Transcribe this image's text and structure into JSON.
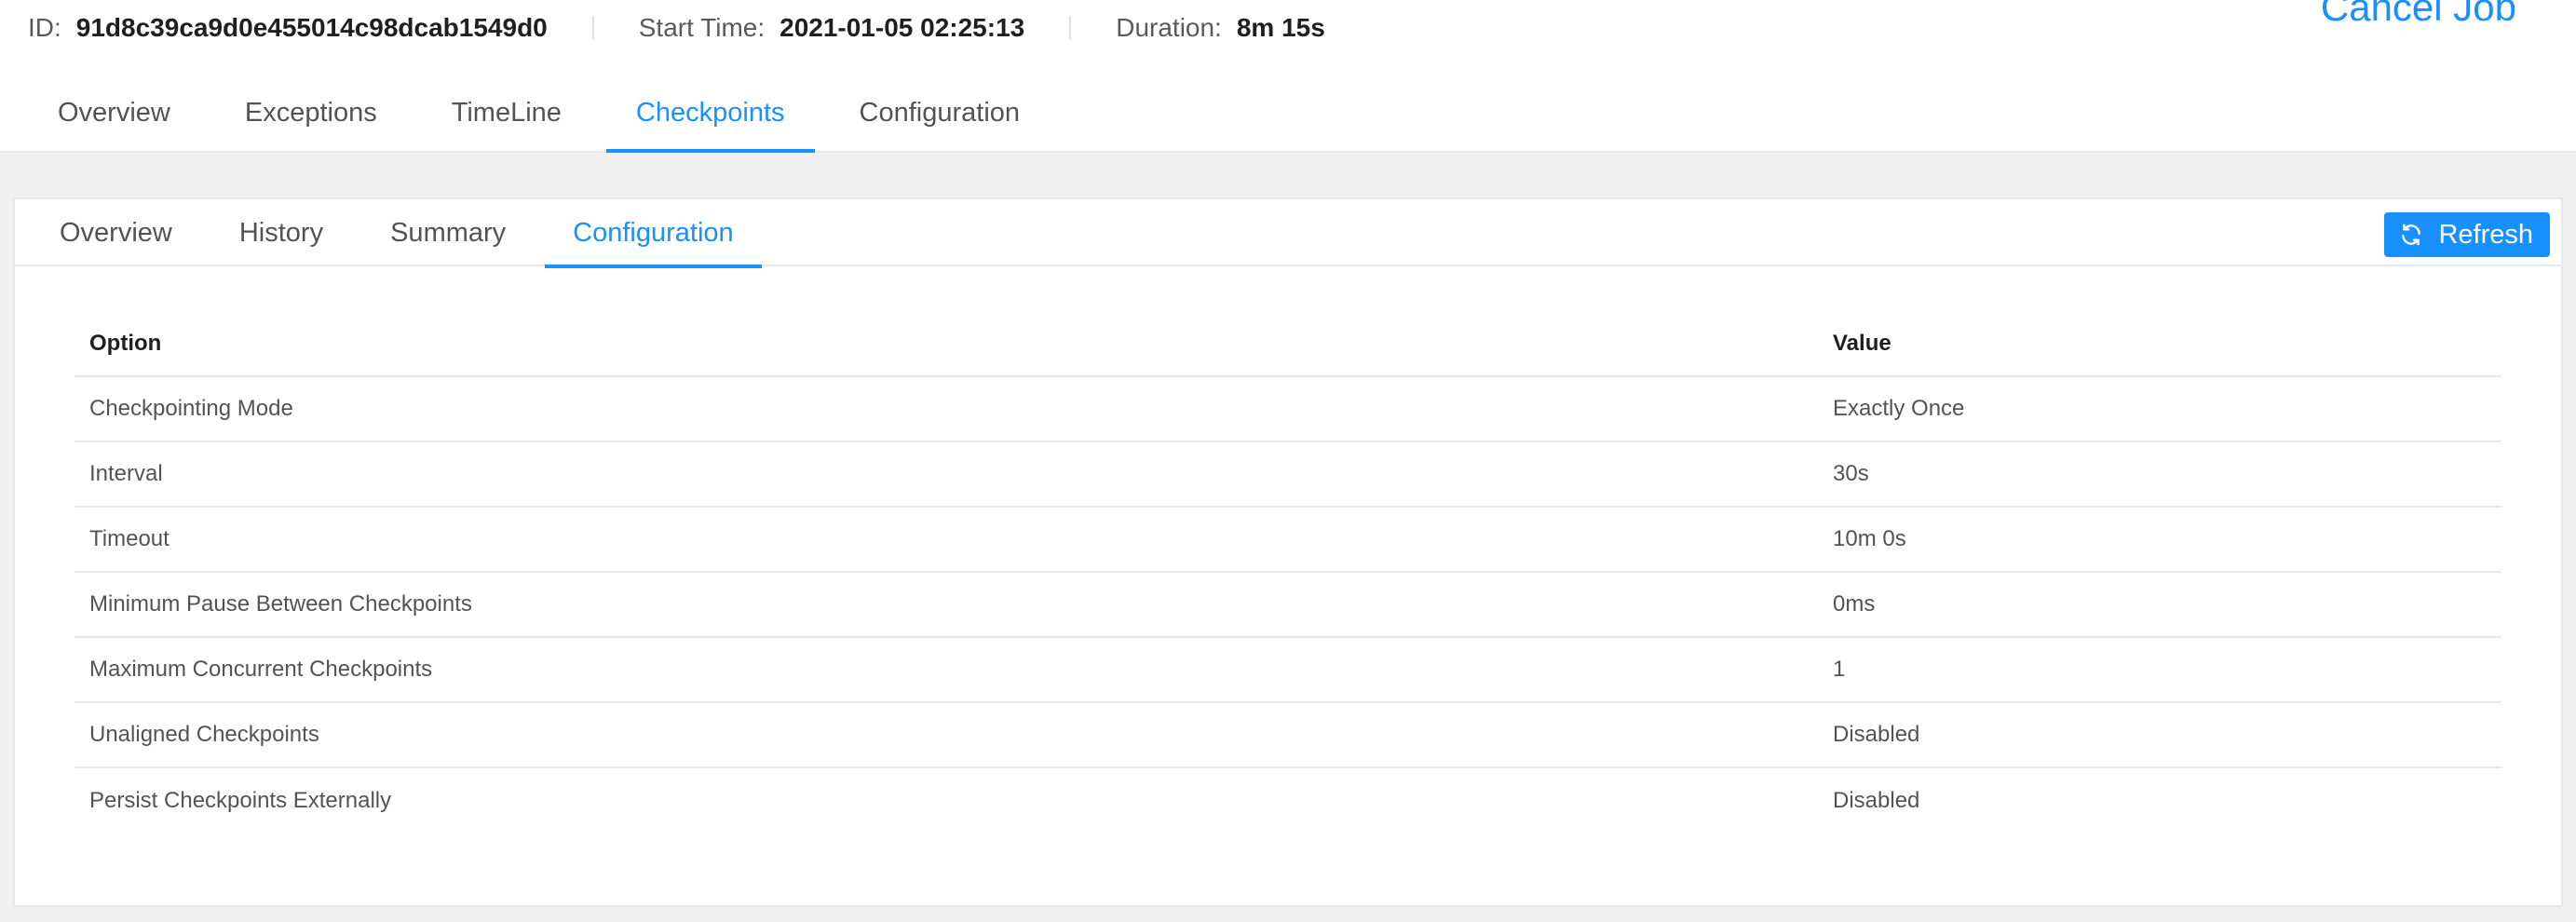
{
  "job_header": {
    "id_label": "ID:",
    "id_value": "91d8c39ca9d0e455014c98dcab1549d0",
    "start_time_label": "Start Time:",
    "start_time_value": "2021-01-05 02:25:13",
    "duration_label": "Duration:",
    "duration_value": "8m 15s",
    "cancel_label": "Cancel Job"
  },
  "main_tabs": [
    {
      "label": "Overview",
      "active": false
    },
    {
      "label": "Exceptions",
      "active": false
    },
    {
      "label": "TimeLine",
      "active": false
    },
    {
      "label": "Checkpoints",
      "active": true
    },
    {
      "label": "Configuration",
      "active": false
    }
  ],
  "sub_tabs": [
    {
      "label": "Overview",
      "active": false
    },
    {
      "label": "History",
      "active": false
    },
    {
      "label": "Summary",
      "active": false
    },
    {
      "label": "Configuration",
      "active": true
    }
  ],
  "refresh_button": {
    "label": "Refresh",
    "icon": "refresh-icon"
  },
  "config_table": {
    "headers": {
      "option": "Option",
      "value": "Value"
    },
    "rows": [
      {
        "option": "Checkpointing Mode",
        "value": "Exactly Once"
      },
      {
        "option": "Interval",
        "value": "30s"
      },
      {
        "option": "Timeout",
        "value": "10m 0s"
      },
      {
        "option": "Minimum Pause Between Checkpoints",
        "value": "0ms"
      },
      {
        "option": "Maximum Concurrent Checkpoints",
        "value": "1"
      },
      {
        "option": "Unaligned Checkpoints",
        "value": "Disabled"
      },
      {
        "option": "Persist Checkpoints Externally",
        "value": "Disabled"
      }
    ]
  },
  "colors": {
    "accent": "#1890ff",
    "page_background": "#f0f0f0",
    "border": "#e8e8e8"
  }
}
